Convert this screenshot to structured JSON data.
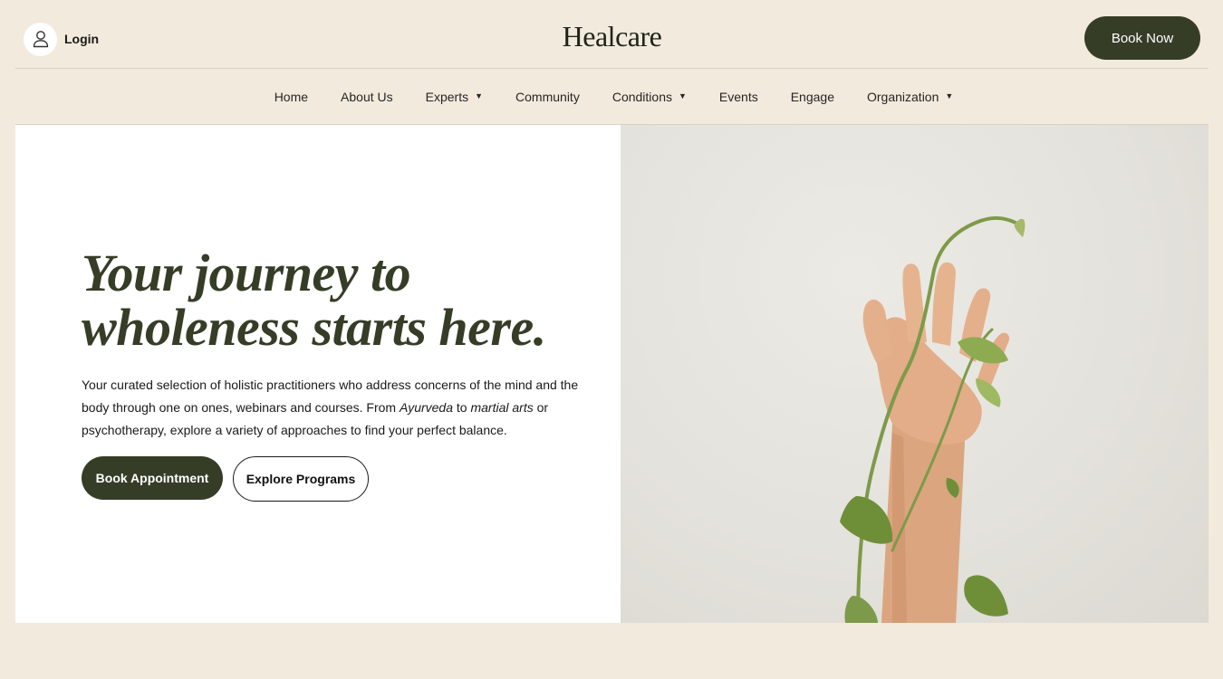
{
  "header": {
    "login_label": "Login",
    "brand": "Healcare",
    "book_now_label": "Book Now"
  },
  "nav": {
    "items": [
      {
        "label": "Home",
        "has_dropdown": false
      },
      {
        "label": "About Us",
        "has_dropdown": false
      },
      {
        "label": "Experts",
        "has_dropdown": true
      },
      {
        "label": "Community",
        "has_dropdown": false
      },
      {
        "label": "Conditions",
        "has_dropdown": true
      },
      {
        "label": "Events",
        "has_dropdown": false
      },
      {
        "label": "Engage",
        "has_dropdown": false
      },
      {
        "label": "Organization",
        "has_dropdown": true
      }
    ]
  },
  "hero": {
    "title_line1": "Your journey to",
    "title_line2": "wholeness starts here.",
    "text_part1": "Your curated selection of holistic practitioners who address concerns of the mind and the body through one on ones, webinars and courses. From ",
    "text_em1": "Ayurveda",
    "text_part2": " to ",
    "text_em2": "martial arts",
    "text_part3": " or psychotherapy, explore a variety of approaches to find your perfect balance.",
    "primary_button": "Book Appointment",
    "secondary_button": "Explore Programs"
  },
  "icons": {
    "login": "user-icon",
    "dropdown": "chevron-down-icon"
  },
  "colors": {
    "background": "#f2eadd",
    "accent": "#363d27",
    "panel": "#ffffff"
  }
}
